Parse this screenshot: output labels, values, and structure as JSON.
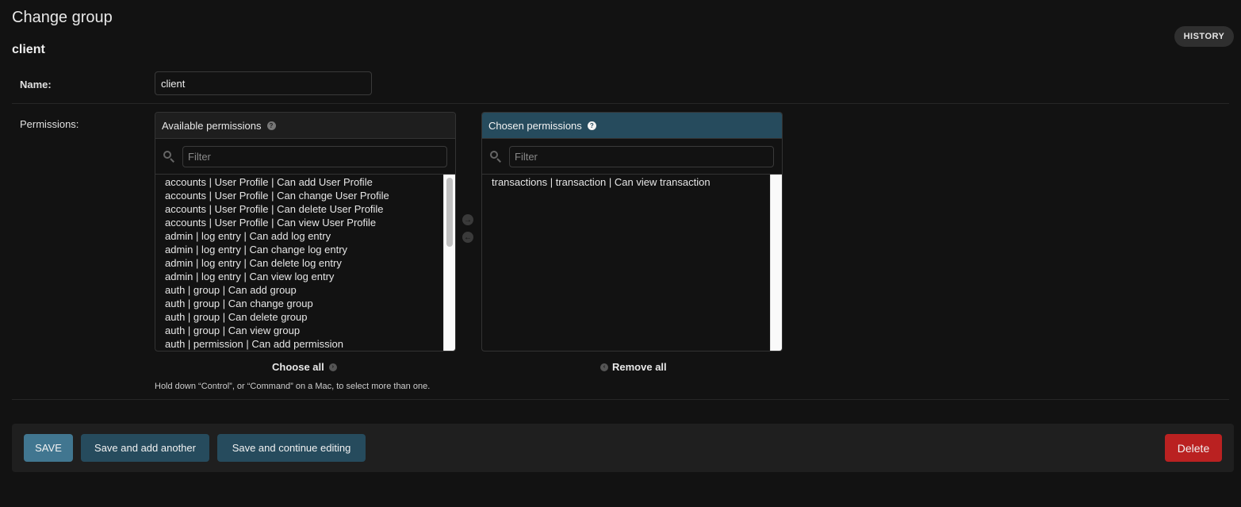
{
  "header": {
    "title": "Change group",
    "object_name": "client",
    "history_label": "HISTORY"
  },
  "form": {
    "name_label": "Name:",
    "name_value": "client",
    "permissions_label": "Permissions:"
  },
  "available": {
    "title": "Available permissions",
    "help_icon": "question-circle-icon",
    "filter_placeholder": "Filter",
    "options": [
      "accounts | User Profile | Can add User Profile",
      "accounts | User Profile | Can change User Profile",
      "accounts | User Profile | Can delete User Profile",
      "accounts | User Profile | Can view User Profile",
      "admin | log entry | Can add log entry",
      "admin | log entry | Can change log entry",
      "admin | log entry | Can delete log entry",
      "admin | log entry | Can view log entry",
      "auth | group | Can add group",
      "auth | group | Can change group",
      "auth | group | Can delete group",
      "auth | group | Can view group",
      "auth | permission | Can add permission"
    ],
    "choose_all_label": "Choose all"
  },
  "chosen": {
    "title": "Chosen permissions",
    "help_icon": "question-circle-icon",
    "filter_placeholder": "Filter",
    "options": [
      "transactions | transaction | Can view transaction"
    ],
    "remove_all_label": "Remove all"
  },
  "help_text": "Hold down “Control”, or “Command” on a Mac, to select more than one.",
  "actions": {
    "save": "SAVE",
    "save_add_another": "Save and add another",
    "save_continue": "Save and continue editing",
    "delete": "Delete"
  },
  "colors": {
    "background": "#121212",
    "chosen_header": "#264b5d",
    "save_button": "#417690",
    "secondary_button": "#264b5d",
    "delete_button": "#ba2121"
  }
}
